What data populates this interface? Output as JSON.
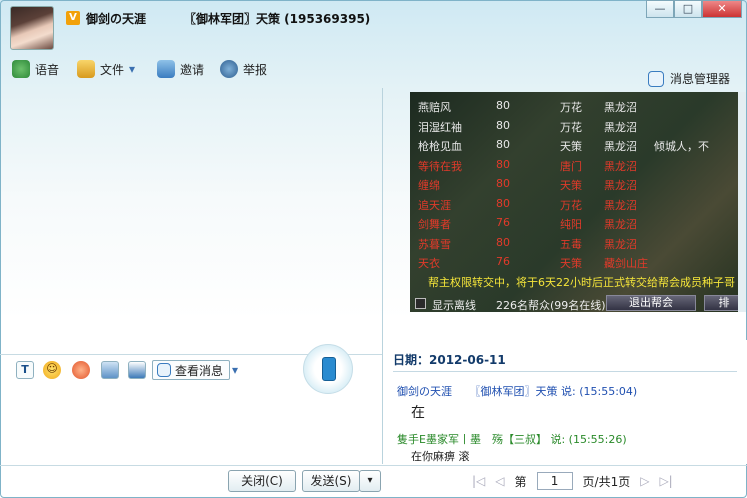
{
  "window": {
    "vip_badge": "V",
    "contact_name": "御剑の天涯",
    "guild_title": "〖御林军团〗天策 (195369395)",
    "controls": {
      "minimize": "—",
      "maximize": "□",
      "close": "✕"
    }
  },
  "toolbar": {
    "items": [
      {
        "label": "语音",
        "icon": "voice-icon"
      },
      {
        "label": "文件",
        "icon": "file-icon"
      },
      {
        "label": "邀请",
        "icon": "invite-icon"
      },
      {
        "label": "举报",
        "icon": "report-icon"
      }
    ],
    "file_dropdown_arrow": "▾",
    "message_manager": "消息管理器"
  },
  "input_toolbar": {
    "font_icon_glyph": "T",
    "emoji_glyph": "☺",
    "view_messages": "查看消息",
    "dropdown_arrow": "▾"
  },
  "guild_panel": {
    "rows": [
      {
        "name": "燕赔风",
        "level": "80",
        "school": "万花",
        "map": "黑龙沼",
        "extra": "",
        "color": "#e8e8e8"
      },
      {
        "name": "泪湿红袖",
        "level": "80",
        "school": "万花",
        "map": "黑龙沼",
        "extra": "",
        "color": "#e8e8e8"
      },
      {
        "name": "枪枪见血",
        "level": "80",
        "school": "天策",
        "map": "黑龙沼",
        "extra": "倾城人，不",
        "color": "#e8e8e8"
      },
      {
        "name": "等待在我",
        "level": "80",
        "school": "唐门",
        "map": "黑龙沼",
        "extra": "",
        "color": "#e23a2a"
      },
      {
        "name": "缠绵",
        "level": "80",
        "school": "天策",
        "map": "黑龙沼",
        "extra": "",
        "color": "#e23a2a"
      },
      {
        "name": "追天涯",
        "level": "80",
        "school": "万花",
        "map": "黑龙沼",
        "extra": "",
        "color": "#e23a2a"
      },
      {
        "name": "剑舞者",
        "level": "76",
        "school": "纯阳",
        "map": "黑龙沼",
        "extra": "",
        "color": "#e23a2a"
      },
      {
        "name": "苏暮雪",
        "level": "80",
        "school": "五毒",
        "map": "黑龙沼",
        "extra": "",
        "color": "#e23a2a"
      },
      {
        "name": "天衣",
        "level": "76",
        "school": "天策",
        "map": "藏剑山庄",
        "extra": "",
        "color": "#e23a2a"
      }
    ],
    "notice": "帮主权限转交中，将于6天22小时后正式转交给帮会成员种子哥",
    "show_offline": "显示离线",
    "member_count": "226名帮众(99名在线)",
    "leave_button": "退出帮会",
    "extra_button": "排"
  },
  "history": {
    "date": "日期：2012-06-11",
    "messages": [
      {
        "sender": "御剑の天涯",
        "target": "〖御林军团〗天策",
        "said": "说:",
        "time": "(15:55:04)",
        "text": "在",
        "color": "#1f4fb0"
      },
      {
        "sender": "隻手Ε墨家军丨墨　殇【三叔】",
        "target": "",
        "said": "说:",
        "time": "(15:55:26)",
        "text": "在你麻痹 滚",
        "color": "#2a8a2a"
      }
    ]
  },
  "bottom": {
    "close_button": "关闭(C)",
    "send_button": "发送(S)",
    "send_arrow": "▾",
    "pager": {
      "first": "|◁",
      "prev": "◁",
      "label_page": "第",
      "page": "1",
      "label_total": "页/共1页",
      "next": "▷",
      "last": "▷|"
    }
  }
}
